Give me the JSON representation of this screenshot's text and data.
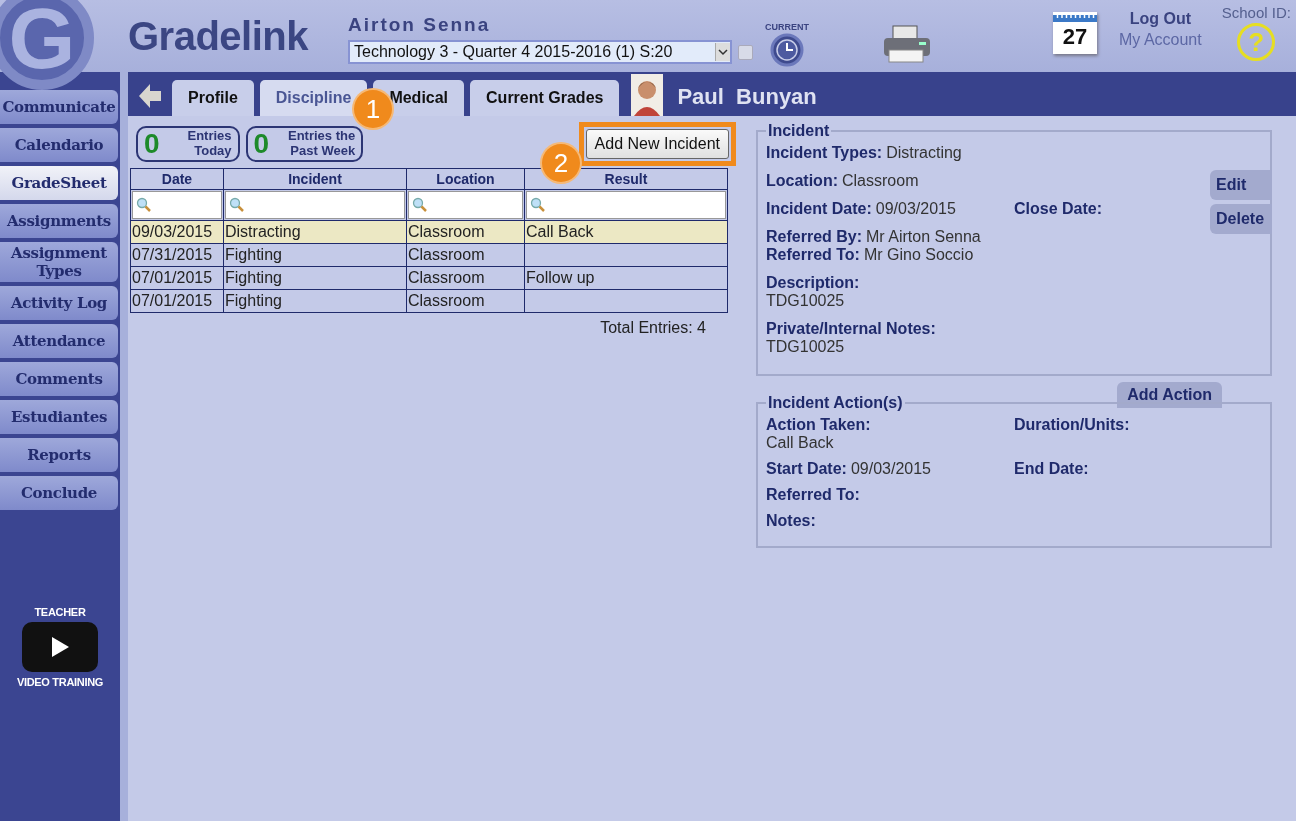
{
  "header": {
    "logo_mark": "G",
    "logo": "Gradelink",
    "teacher": "Airton Senna",
    "class_select": {
      "value": "Technology 3 - Quarter 4 2015-2016 (1) S:20"
    },
    "current_checkbox": {
      "checked": false
    },
    "current_label": "CURRENT",
    "calendar_day": "27",
    "log_out": "Log Out",
    "my_account": "My Account",
    "school_id": "School ID:",
    "help": "?"
  },
  "sidebar": {
    "items": [
      {
        "label": "Communicate",
        "selected": false
      },
      {
        "label": "Calendario",
        "selected": false
      },
      {
        "label": "GradeSheet",
        "selected": true
      },
      {
        "label": "Assignments",
        "selected": false
      },
      {
        "label": "Assignment Types",
        "selected": false
      },
      {
        "label": "Activity Log",
        "selected": false
      },
      {
        "label": "Attendance",
        "selected": false
      },
      {
        "label": "Comments",
        "selected": false
      },
      {
        "label": "Estudiantes",
        "selected": false
      },
      {
        "label": "Reports",
        "selected": false
      },
      {
        "label": "Conclude",
        "selected": false
      }
    ],
    "video": {
      "top": "TEACHER",
      "bottom": "VIDEO TRAINING"
    }
  },
  "tabs": [
    {
      "label": "Profile",
      "selected": false
    },
    {
      "label": "Discipline",
      "selected": true
    },
    {
      "label": "Medical",
      "selected": false
    },
    {
      "label": "Current Grades",
      "selected": false
    }
  ],
  "student": {
    "name": "Paul  Bunyan"
  },
  "counters": [
    {
      "count": "0",
      "label": "Entries Today"
    },
    {
      "count": "0",
      "label": "Entries the Past Week"
    }
  ],
  "add_button": "Add New Incident",
  "callouts": [
    "1",
    "2"
  ],
  "table": {
    "columns": [
      "Date",
      "Incident",
      "Location",
      "Result"
    ],
    "rows": [
      {
        "cells": [
          "09/03/2015",
          "Distracting",
          "Classroom",
          "Call Back"
        ],
        "selected": true
      },
      {
        "cells": [
          "07/31/2015",
          "Fighting",
          "Classroom",
          ""
        ],
        "selected": false
      },
      {
        "cells": [
          "07/01/2015",
          "Fighting",
          "Classroom",
          "Follow up"
        ],
        "selected": false
      },
      {
        "cells": [
          "07/01/2015",
          "Fighting",
          "Classroom",
          ""
        ],
        "selected": false
      }
    ],
    "total": "Total Entries: 4"
  },
  "incident": {
    "legend": "Incident",
    "buttons": [
      "Edit",
      "Delete"
    ],
    "groups": [
      [
        [
          {
            "label": "Incident Types:",
            "value": "Distracting",
            "kind": "inline"
          }
        ]
      ],
      [
        [
          {
            "label": "Location:",
            "value": "Classroom",
            "kind": "inline"
          }
        ]
      ],
      [
        [
          {
            "label": "Incident Date:",
            "value": "09/03/2015",
            "kind": "inline"
          },
          {
            "label": "Close Date:",
            "kind": "inline"
          }
        ]
      ],
      [
        [
          {
            "label": "Referred By:",
            "value": "Mr Airton Senna",
            "kind": "inline"
          }
        ],
        [
          {
            "label": "Referred To:",
            "value": "Mr Gino Soccio",
            "kind": "inline"
          }
        ]
      ],
      [
        [
          {
            "label": "Description:",
            "value": "TDG10025",
            "kind": "stacked"
          }
        ]
      ],
      [
        [
          {
            "label": "Private/Internal Notes:",
            "value": "TDG10025",
            "kind": "stacked"
          }
        ]
      ]
    ]
  },
  "actions": {
    "legend": "Incident Action(s)",
    "add_button": "Add Action",
    "groups": [
      [
        [
          {
            "label": "Action Taken:",
            "value": "Call Back",
            "kind": "stacked"
          },
          {
            "label": "Duration/Units:",
            "kind": "inline"
          }
        ]
      ],
      [
        [
          {
            "label": "Start Date:",
            "value": "09/03/2015",
            "kind": "inline"
          },
          {
            "label": "End Date:",
            "kind": "inline"
          }
        ]
      ],
      [
        [
          {
            "label": "Referred To:",
            "kind": "inline"
          }
        ]
      ],
      [
        [
          {
            "label": "Notes:",
            "kind": "inline"
          }
        ]
      ]
    ]
  }
}
